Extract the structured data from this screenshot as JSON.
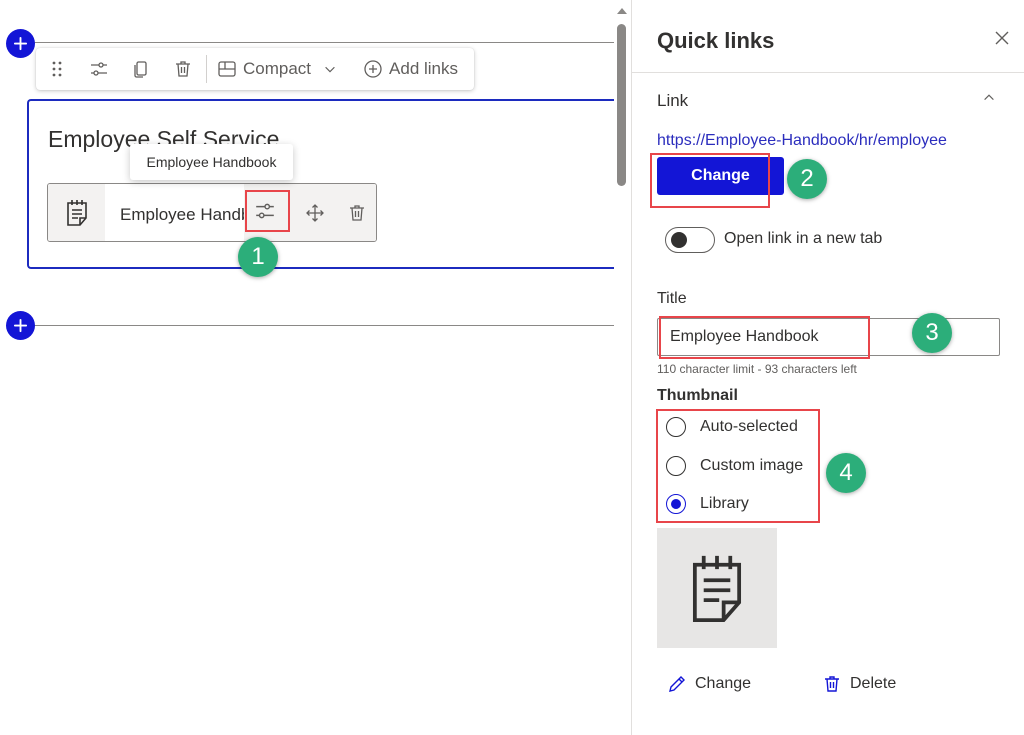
{
  "canvas": {
    "toolbar": {
      "drag_icon": "drag-handle-icon",
      "settings_icon": "settings-sliders-icon",
      "duplicate_icon": "duplicate-icon",
      "delete_icon": "delete-icon",
      "layout_label": "Compact",
      "add_links_label": "Add links"
    },
    "webpart_title": "Employee Self Service",
    "tooltip": "Employee Handbook",
    "link_item": {
      "label": "Employee Handbook",
      "thumbnail_icon": "notepad-icon"
    }
  },
  "callouts": [
    "1",
    "2",
    "3",
    "4"
  ],
  "pane": {
    "title": "Quick links",
    "section": "Link",
    "url": "https://Employee-Handbook/hr/employee",
    "change_button": "Change",
    "open_new_tab_label": "Open link in a new tab",
    "open_new_tab_on": false,
    "title_label": "Title",
    "title_value": "Employee Handbook",
    "char_limit": "110 character limit - 93 characters left",
    "thumbnail_heading": "Thumbnail",
    "thumbnail_options": [
      "Auto-selected",
      "Custom image",
      "Library"
    ],
    "thumbnail_selected": "Library",
    "thumb_change_label": "Change",
    "thumb_delete_label": "Delete"
  },
  "colors": {
    "accent": "#1315d6",
    "highlight": "#e8454a",
    "badge": "#2cae7a",
    "link": "#2b2dbd"
  }
}
